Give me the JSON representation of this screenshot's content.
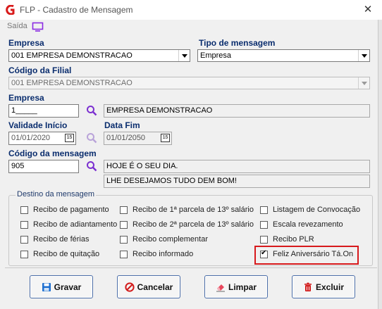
{
  "window": {
    "title": "FLP - Cadastro de Mensagem",
    "close_glyph": "✕"
  },
  "menu": {
    "saida": "Saída"
  },
  "fields": {
    "empresa_label": "Empresa",
    "empresa_value": "001 EMPRESA DEMONSTRACAO",
    "tipo_label": "Tipo de mensagem",
    "tipo_value": "Empresa",
    "filial_label": "Código da Filial",
    "filial_value": "001 EMPRESA DEMONSTRACAO",
    "empresa2_label": "Empresa",
    "empresa2_code": "1_____",
    "empresa2_name": "EMPRESA DEMONSTRACAO",
    "validade_label": "Validade Início",
    "validade_value": "01/01/2020",
    "datafim_label": "Data Fim",
    "datafim_value": "01/01/2050",
    "calendar_glyph": "15",
    "codigo_label": "Código da mensagem",
    "codigo_value": "905",
    "mensagem_line1": "HOJE É O SEU DIA.",
    "mensagem_line2": "LHE DESEJAMOS TUDO DEM BOM!"
  },
  "destino": {
    "title": "Destino da mensagem",
    "options": [
      {
        "label": "Recibo de pagamento",
        "checked": false
      },
      {
        "label": "Recibo de 1ª parcela de 13º salário",
        "checked": false
      },
      {
        "label": "Listagem de Convocação",
        "checked": false
      },
      {
        "label": "Recibo de adiantamento",
        "checked": false
      },
      {
        "label": "Recibo de 2ª parcela de 13º salário",
        "checked": false
      },
      {
        "label": "Escala revezamento",
        "checked": false
      },
      {
        "label": "Recibo de férias",
        "checked": false
      },
      {
        "label": "Recibo complementar",
        "checked": false
      },
      {
        "label": "Recibo PLR",
        "checked": false
      },
      {
        "label": "Recibo de quitação",
        "checked": false
      },
      {
        "label": "Recibo informado",
        "checked": false
      },
      {
        "label": "Feliz Aniversário Tá.On",
        "checked": true
      }
    ]
  },
  "buttons": {
    "gravar": "Gravar",
    "cancelar": "Cancelar",
    "limpar": "Limpar",
    "excluir": "Excluir"
  },
  "colors": {
    "label": "#0a2d6e",
    "highlight": "#d7191c",
    "button_border": "#4c6ea8",
    "icon_purple": "#7b2fd0"
  }
}
